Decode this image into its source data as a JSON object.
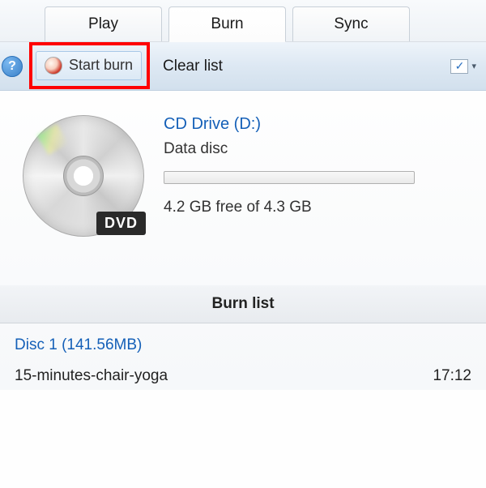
{
  "tabs": {
    "play": "Play",
    "burn": "Burn",
    "sync": "Sync"
  },
  "toolbar": {
    "start_burn_label": "Start burn",
    "clear_list_label": "Clear list"
  },
  "drive": {
    "title": "CD Drive (D:)",
    "type": "Data disc",
    "free_space": "4.2 GB free of 4.3 GB",
    "media_label": "DVD"
  },
  "burn_list": {
    "header": "Burn list",
    "disc_label": "Disc 1 (141.56MB)",
    "items": [
      {
        "name": "15-minutes-chair-yoga",
        "duration": "17:12"
      }
    ]
  },
  "help_icon_glyph": "?",
  "options_check_glyph": "✓",
  "options_arrow_glyph": "▾"
}
